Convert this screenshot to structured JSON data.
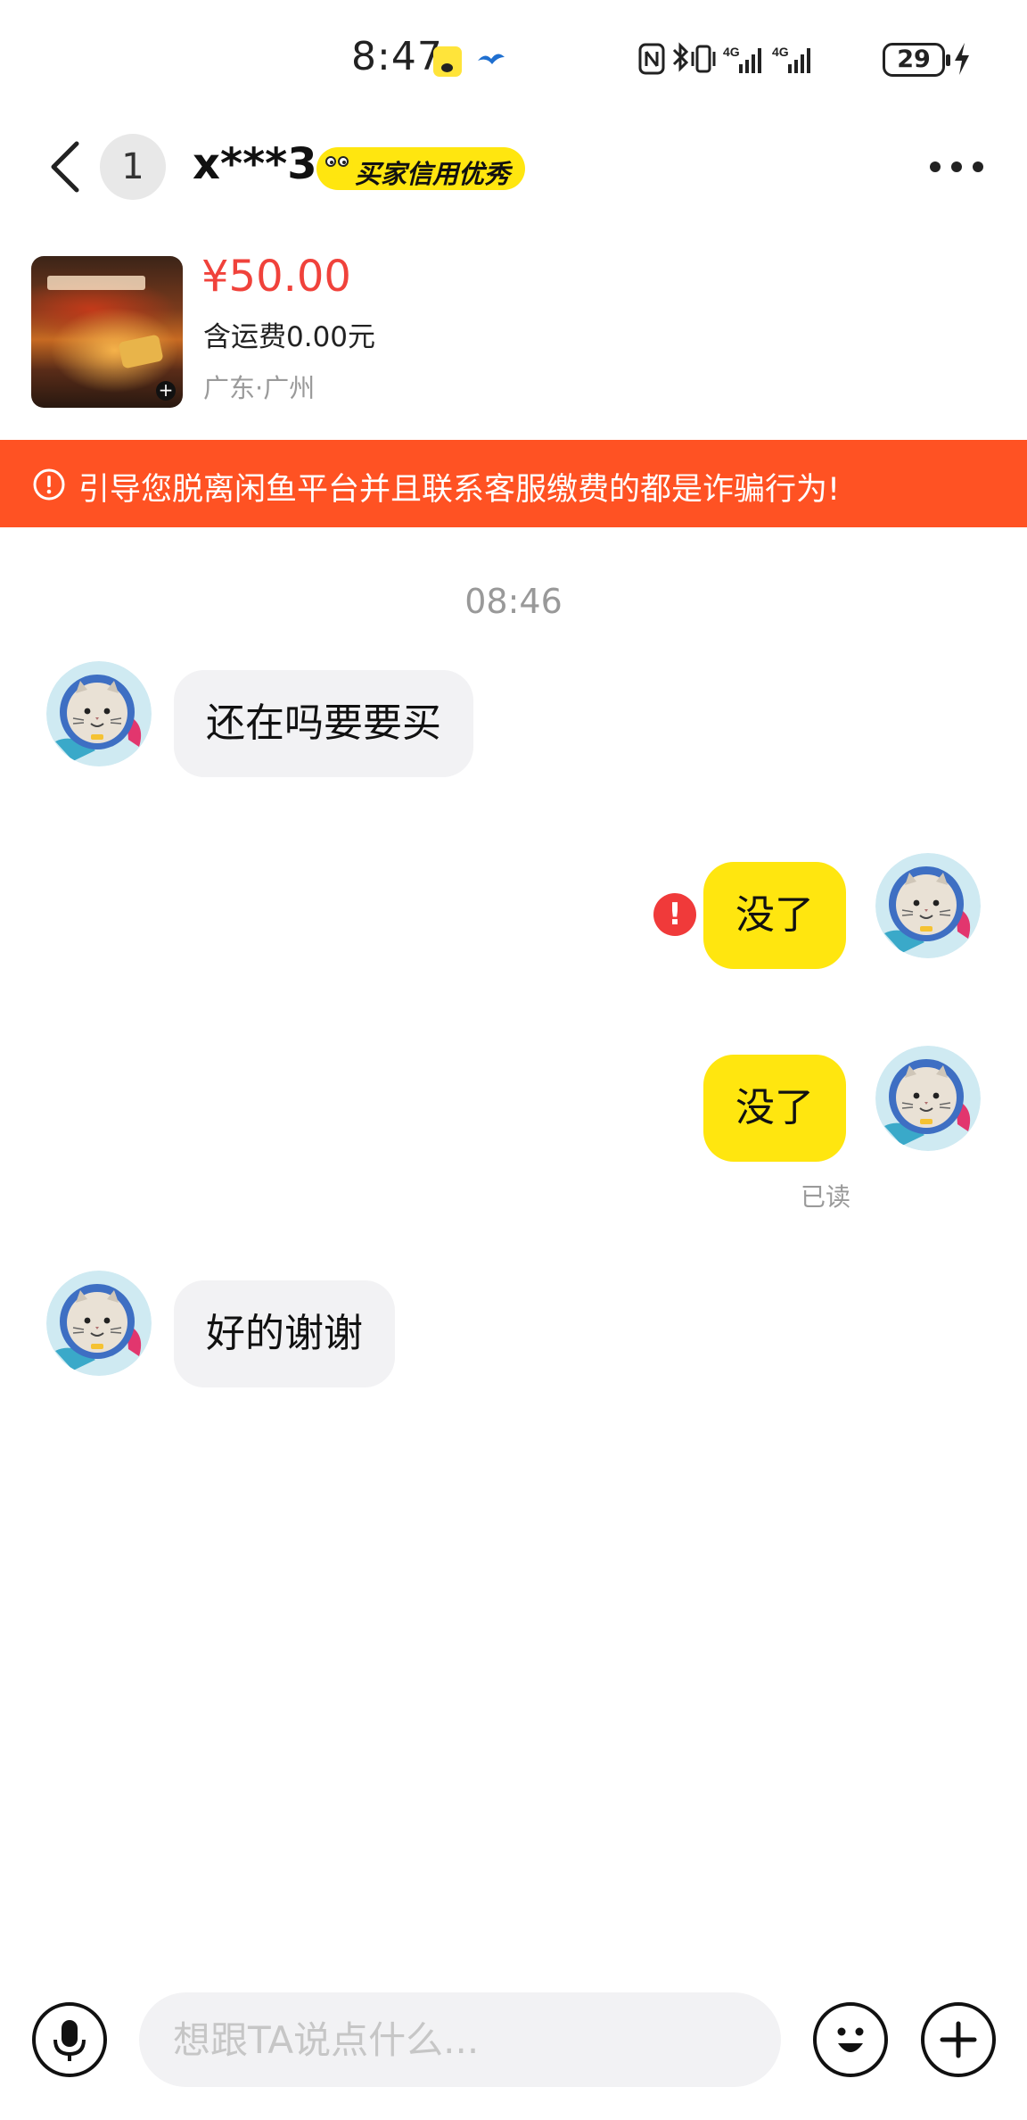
{
  "status_bar": {
    "time": "8:47",
    "battery": "29",
    "icons": [
      "app-icon",
      "bird-icon",
      "nfc-icon",
      "bluetooth-icon",
      "vibrate-icon",
      "signal-4g-icon",
      "signal-4g-icon",
      "battery-icon",
      "charging-icon"
    ]
  },
  "header": {
    "unread_count": "1",
    "user_name": "x***3",
    "credit_badge": "买家信用优秀"
  },
  "item": {
    "price": "¥50.00",
    "shipping": "含运费0.00元",
    "location": "广东·广州"
  },
  "warning": {
    "text": "引导您脱离闲鱼平台并且联系客服缴费的都是诈骗行为!"
  },
  "chat": {
    "timestamp": "08:46",
    "messages": [
      {
        "side": "in",
        "text": "还在吗要要买"
      },
      {
        "side": "out",
        "text": "没了",
        "status": "failed"
      },
      {
        "side": "out",
        "text": "没了",
        "status_text": "已读"
      },
      {
        "side": "in",
        "text": "好的谢谢"
      }
    ]
  },
  "input": {
    "placeholder": "想跟TA说点什么..."
  },
  "colors": {
    "accent_yellow": "#ffe60f",
    "warning_orange": "#ff5223",
    "price_red": "#f0423b",
    "error_red": "#f03a3a"
  }
}
